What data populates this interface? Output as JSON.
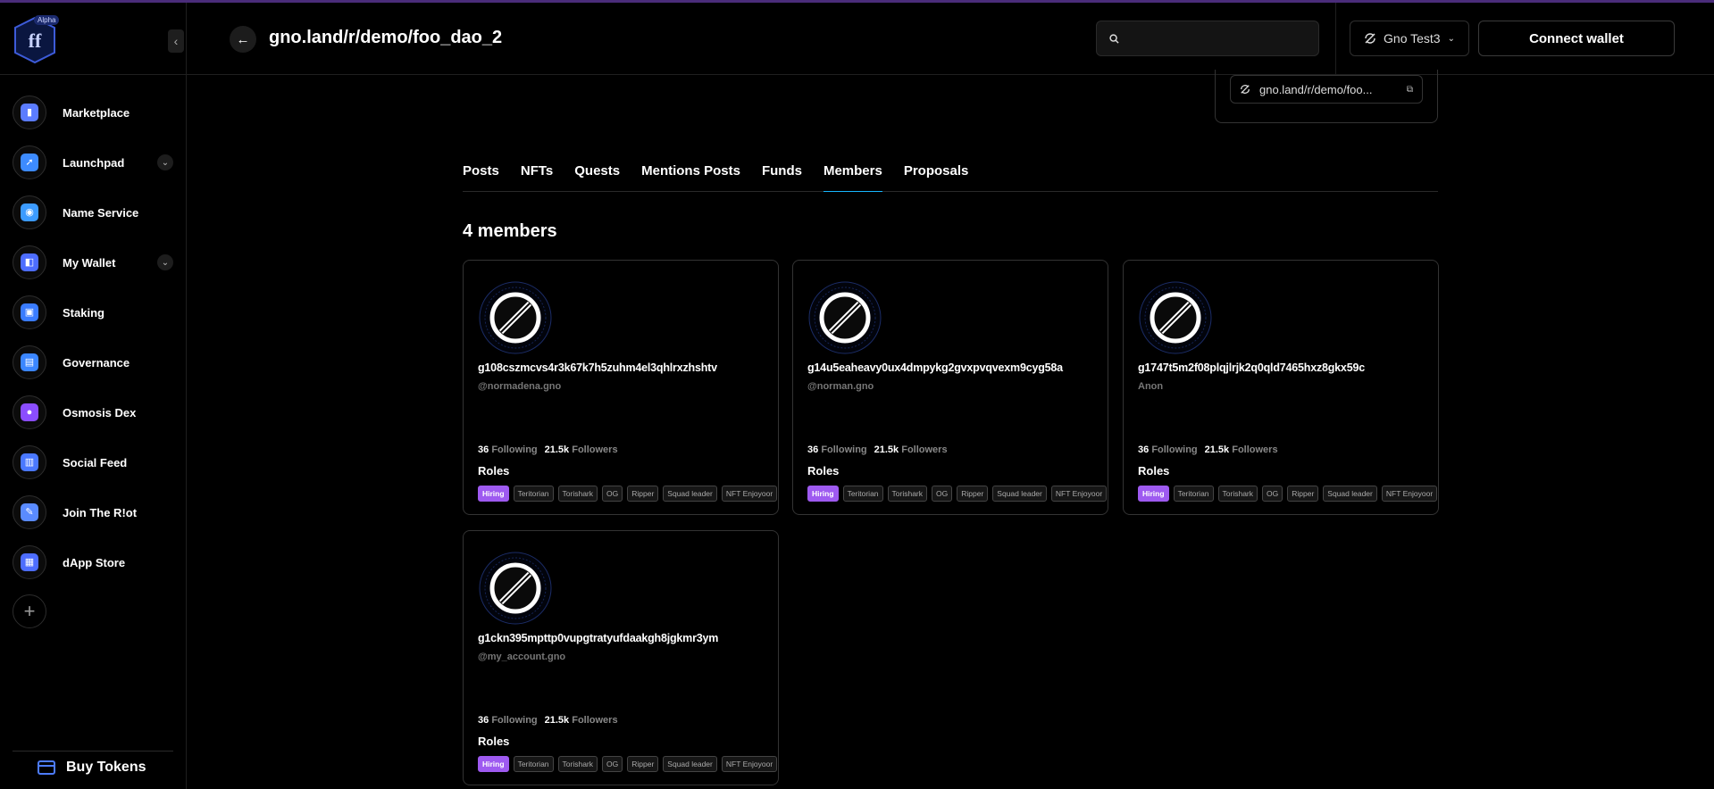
{
  "app": {
    "badge": "Alpha"
  },
  "sidebar": {
    "items": [
      {
        "label": "Marketplace",
        "icon": "marketplace-icon",
        "color": "#5b7cff",
        "expandable": false
      },
      {
        "label": "Launchpad",
        "icon": "rocket-icon",
        "color": "#3d8bff",
        "expandable": true
      },
      {
        "label": "Name Service",
        "icon": "compass-icon",
        "color": "#3c9bff",
        "expandable": false
      },
      {
        "label": "My Wallet",
        "icon": "wallet-icon",
        "color": "#4d6dff",
        "expandable": true
      },
      {
        "label": "Staking",
        "icon": "staking-icon",
        "color": "#3a7cff",
        "expandable": false
      },
      {
        "label": "Governance",
        "icon": "governance-icon",
        "color": "#3b86ff",
        "expandable": false
      },
      {
        "label": "Osmosis Dex",
        "icon": "osmosis-icon",
        "color": "#8b4dff",
        "expandable": false
      },
      {
        "label": "Social Feed",
        "icon": "social-feed-icon",
        "color": "#4a78ff",
        "expandable": false
      },
      {
        "label": "Join The R!ot",
        "icon": "riot-icon",
        "color": "#5a8bff",
        "expandable": false
      },
      {
        "label": "dApp Store",
        "icon": "dapp-store-icon",
        "color": "#4d6dff",
        "expandable": false
      }
    ],
    "buy_tokens": "Buy Tokens"
  },
  "header": {
    "title": "gno.land/r/demo/foo_dao_2",
    "search_placeholder": "",
    "network": "Gno Test3",
    "connect": "Connect wallet"
  },
  "dao_address": "gno.land/r/demo/foo...",
  "tabs": [
    "Posts",
    "NFTs",
    "Quests",
    "Mentions Posts",
    "Funds",
    "Members",
    "Proposals"
  ],
  "active_tab": "Members",
  "members_count": "4 members",
  "members": [
    {
      "address": "g108cszmcvs4r3k67k7h5zuhm4el3qhlrxzhshtv",
      "handle": "@normadena.gno",
      "following": "36",
      "followers": "21.5k"
    },
    {
      "address": "g14u5eaheavy0ux4dmpykg2gvxpvqvexm9cyg58a",
      "handle": "@norman.gno",
      "following": "36",
      "followers": "21.5k"
    },
    {
      "address": "g1747t5m2f08plqjlrjk2q0qld7465hxz8gkx59c",
      "handle": "Anon",
      "following": "36",
      "followers": "21.5k"
    },
    {
      "address": "g1ckn395mpttp0vupgtratyufdaakgh8jgkmr3ym",
      "handle": "@my_account.gno",
      "following": "36",
      "followers": "21.5k"
    }
  ],
  "labels": {
    "following": "Following",
    "followers": "Followers",
    "roles": "Roles"
  },
  "roles": [
    "Hiring",
    "Teritorian",
    "Torishark",
    "OG",
    "Ripper",
    "Squad leader",
    "NFT Enjoyoor"
  ],
  "colors": {
    "accent_tab": "#16b7ff",
    "hiring": "#9e5af0",
    "top_line": "#4a2c7a"
  }
}
